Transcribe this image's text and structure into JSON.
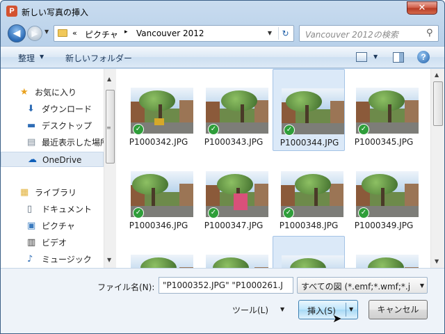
{
  "window": {
    "title": "新しい写真の挿入",
    "app_icon_letter": "P",
    "close_glyph": "✕"
  },
  "nav": {
    "back_glyph": "◀",
    "forward_glyph": "▶",
    "path_overflow": "«",
    "path": [
      "ピクチャ",
      "Vancouver 2012"
    ],
    "path_separator": "▸",
    "dropdown_glyph": "▼",
    "refresh_glyph": "↻",
    "search_placeholder": "Vancouver 2012の検索",
    "search_icon": "⚲"
  },
  "toolbar": {
    "organize": "整理",
    "new_folder": "新しいフォルダー",
    "arrow": "▼",
    "help": "?"
  },
  "sidebar": {
    "items": [
      {
        "label": "お気に入り",
        "icon": "star-icon",
        "glyph": "★",
        "color": "#e9a21f"
      },
      {
        "label": "ダウンロード",
        "icon": "download-folder-icon",
        "glyph": "⬇",
        "color": "#2f6db5"
      },
      {
        "label": "デスクトップ",
        "icon": "desktop-icon",
        "glyph": "▬",
        "color": "#2f6db5"
      },
      {
        "label": "最近表示した場所",
        "icon": "recent-places-icon",
        "glyph": "▤",
        "color": "#7a8896"
      },
      {
        "label": "OneDrive",
        "icon": "onedrive-icon",
        "glyph": "☁",
        "color": "#0f5fb8"
      },
      {
        "label": "ライブラリ",
        "icon": "library-icon",
        "glyph": "▦",
        "color": "#e2b23b"
      },
      {
        "label": "ドキュメント",
        "icon": "documents-icon",
        "glyph": "▯",
        "color": "#5a6a7a"
      },
      {
        "label": "ピクチャ",
        "icon": "pictures-icon",
        "glyph": "▣",
        "color": "#3a7bbf"
      },
      {
        "label": "ビデオ",
        "icon": "videos-icon",
        "glyph": "▥",
        "color": "#333333"
      },
      {
        "label": "ミュージック",
        "icon": "music-icon",
        "glyph": "♪",
        "color": "#2f6db5"
      }
    ],
    "scroll_up": "▲",
    "scroll_down": "▼",
    "grip": "≡"
  },
  "files": [
    {
      "name": "P1000342.JPG",
      "selected": false
    },
    {
      "name": "P1000343.JPG",
      "selected": false
    },
    {
      "name": "P1000344.JPG",
      "selected": true
    },
    {
      "name": "P1000345.JPG",
      "selected": false
    },
    {
      "name": "P1000346.JPG",
      "selected": false
    },
    {
      "name": "P1000347.JPG",
      "selected": false
    },
    {
      "name": "P1000348.JPG",
      "selected": false
    },
    {
      "name": "P1000349.JPG",
      "selected": false
    },
    {
      "name": "",
      "selected": false
    },
    {
      "name": "",
      "selected": false
    },
    {
      "name": "",
      "selected": true
    },
    {
      "name": "",
      "selected": false
    }
  ],
  "check_glyph": "✓",
  "bottom": {
    "filename_label": "ファイル名(N):",
    "filename_value": "\"P1000352.JPG\" \"P1000261.J",
    "filetype_value": "すべての図 (*.emf;*.wmf;*.j",
    "tools": "ツール(L)",
    "insert": "挿入(S)",
    "cancel": "キャンセル",
    "arrow": "▼",
    "cursor_glyph": "➤"
  },
  "colors": {
    "selection": "#dbe9f8",
    "accent": "#3c7fb1",
    "close": "#c84a33"
  }
}
